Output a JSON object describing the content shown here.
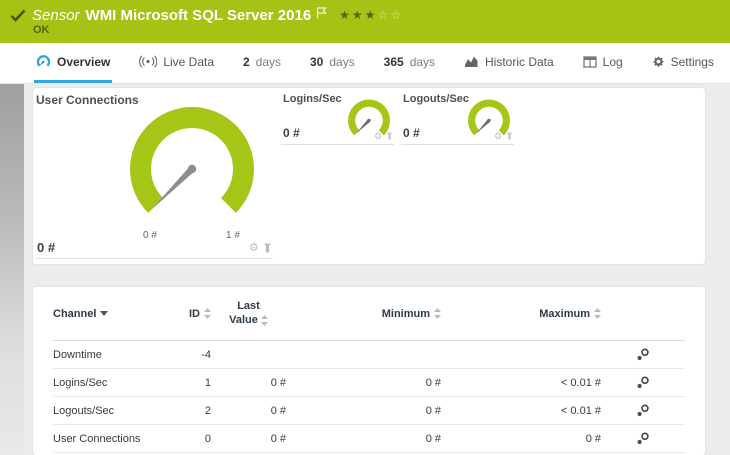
{
  "header": {
    "kind_label": "Sensor",
    "title": "WMI Microsoft SQL Server 2016",
    "status": "OK",
    "rating": {
      "filled": 3,
      "empty": 2,
      "stars_filled": "★★★",
      "stars_empty": "☆☆"
    }
  },
  "tabs": [
    {
      "label": "Overview",
      "active": true
    },
    {
      "label": "Live Data"
    },
    {
      "num": "2",
      "label": "days"
    },
    {
      "num": "30",
      "label": "days"
    },
    {
      "num": "365",
      "label": "days"
    },
    {
      "label": "Historic Data"
    },
    {
      "label": "Log"
    },
    {
      "label": "Settings"
    }
  ],
  "gauges": {
    "primary": {
      "title": "User Connections",
      "value": "0 #",
      "scale_min": "0 #",
      "scale_max": "1 #"
    },
    "secondary": [
      {
        "title": "Logins/Sec",
        "value": "0 #"
      },
      {
        "title": "Logouts/Sec",
        "value": "0 #"
      }
    ]
  },
  "table": {
    "columns": {
      "channel": "Channel",
      "id": "ID",
      "last_line1": "Last",
      "last_line2": "Value",
      "minimum": "Minimum",
      "maximum": "Maximum"
    },
    "rows": [
      {
        "channel": "Downtime",
        "id": "-4",
        "last": "",
        "min": "",
        "max": ""
      },
      {
        "channel": "Logins/Sec",
        "id": "1",
        "last": "0 #",
        "min": "0 #",
        "max": "< 0.01 #"
      },
      {
        "channel": "Logouts/Sec",
        "id": "2",
        "last": "0 #",
        "min": "0 #",
        "max": "< 0.01 #"
      },
      {
        "channel": "User Connections",
        "id": "0",
        "last": "0 #",
        "min": "0 #",
        "max": "0 #"
      }
    ]
  },
  "colors": {
    "status_ok_green": "#a7c114",
    "gauge_green": "#a3c617",
    "accent_blue": "#2fa7de"
  }
}
